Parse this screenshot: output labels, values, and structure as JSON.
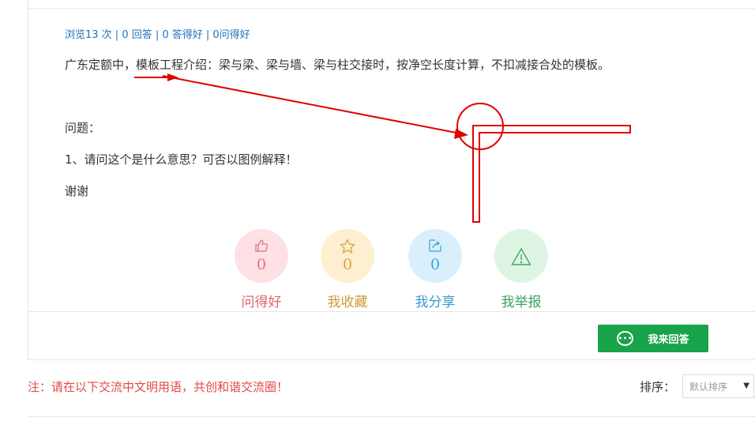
{
  "question": {
    "stats": "浏览13 次 | 0 回答 | 0 答得好 | 0问得好",
    "body_line1": "广东定额中，模板工程介绍：梁与梁、梁与墙、梁与柱交接时，按净空长度计算，不扣减接合处的模板。",
    "body_line2": "问题：",
    "body_line3": "1、请问这个是什么意思？可否以图例解释！",
    "body_line4": "谢谢"
  },
  "actions": [
    {
      "icon": "thumbs-up-icon",
      "count": "0",
      "label": "问得好",
      "color": "#e06571"
    },
    {
      "icon": "star-icon",
      "count": "0",
      "label": "我收藏",
      "color": "#cd9b35"
    },
    {
      "icon": "share-icon",
      "count": "0",
      "label": "我分享",
      "color": "#3b9ad0"
    },
    {
      "icon": "warning-icon",
      "count": "0",
      "label": "我举报",
      "color": "#3ca05c"
    }
  ],
  "answer_button": {
    "label": "我来回答",
    "color": "#19a34a"
  },
  "notice": "注：请在以下交流中文明用语，共创和谐交流圈！",
  "sort": {
    "label": "排序：",
    "selected": "默认排序"
  },
  "annotation_color": "#e00000"
}
